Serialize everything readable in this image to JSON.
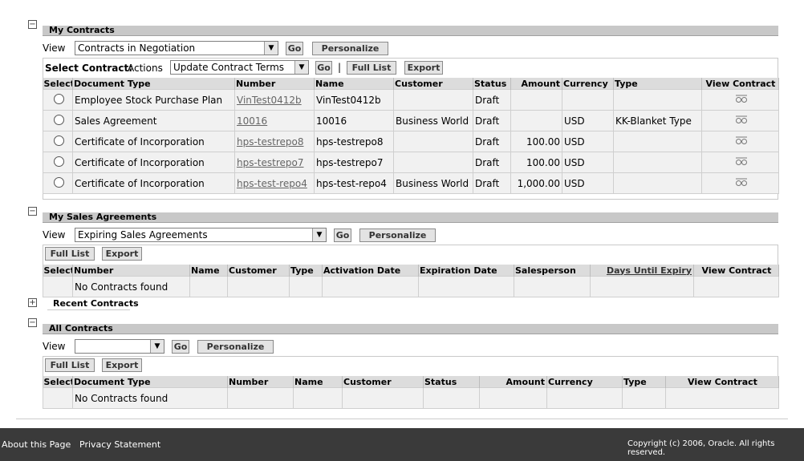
{
  "my_contracts": {
    "title": "My Contracts",
    "view_label": "View",
    "view_value": "Contracts in Negotiation",
    "go": "Go",
    "personalize": "Personalize",
    "select_contract_label": "Select Contract:",
    "actions_label": "Actions",
    "actions_value": "Update Contract Terms",
    "go2": "Go",
    "separator": "|",
    "full_list": "Full List",
    "export": "Export",
    "columns": [
      "Select",
      "Document Type",
      "Number",
      "Name",
      "Customer",
      "Status",
      "Amount",
      "Currency",
      "Type",
      "View Contract"
    ],
    "rows": [
      {
        "doc_type": "Employee Stock Purchase Plan",
        "number": "VinTest0412b",
        "name": "VinTest0412b",
        "customer": "",
        "status": "Draft",
        "amount": "",
        "currency": "",
        "type": ""
      },
      {
        "doc_type": "Sales Agreement",
        "number": "10016",
        "name": "10016",
        "customer": "Business World",
        "status": "Draft",
        "amount": "",
        "currency": "USD",
        "type": "KK-Blanket Type"
      },
      {
        "doc_type": "Certificate of Incorporation",
        "number": "hps-testrepo8",
        "name": "hps-testrepo8",
        "customer": "",
        "status": "Draft",
        "amount": "100.00",
        "currency": "USD",
        "type": ""
      },
      {
        "doc_type": "Certificate of Incorporation",
        "number": "hps-testrepo7",
        "name": "hps-testrepo7",
        "customer": "",
        "status": "Draft",
        "amount": "100.00",
        "currency": "USD",
        "type": ""
      },
      {
        "doc_type": "Certificate of Incorporation",
        "number": "hps-test-repo4",
        "name": "hps-test-repo4",
        "customer": "Business World",
        "status": "Draft",
        "amount": "1,000.00",
        "currency": "USD",
        "type": ""
      }
    ]
  },
  "sales_agreements": {
    "title": "My Sales Agreements",
    "view_label": "View",
    "view_value": "Expiring Sales Agreements",
    "go": "Go",
    "personalize": "Personalize",
    "full_list": "Full List",
    "export": "Export",
    "columns": [
      "Select",
      "Number",
      "Name",
      "Customer",
      "Type",
      "Activation Date",
      "Expiration Date",
      "Salesperson",
      "Days Until Expiry",
      "View Contract"
    ],
    "empty": "No Contracts found"
  },
  "recent_contracts": {
    "title": "Recent Contracts"
  },
  "all_contracts": {
    "title": "All Contracts",
    "view_label": "View",
    "view_value": "",
    "go": "Go",
    "personalize": "Personalize",
    "full_list": "Full List",
    "export": "Export",
    "columns": [
      "Select",
      "Document Type",
      "Number",
      "Name",
      "Customer",
      "Status",
      "Amount",
      "Currency",
      "Type",
      "View Contract"
    ],
    "empty": "No Contracts found"
  },
  "footer": {
    "about": "About this Page",
    "privacy": "Privacy Statement",
    "copyright": "Copyright (c) 2006, Oracle. All rights reserved."
  },
  "icons": {
    "collapse": "minus-icon",
    "expand": "plus-icon",
    "view": "glasses-icon",
    "dropdown": "chevron-down-icon"
  }
}
